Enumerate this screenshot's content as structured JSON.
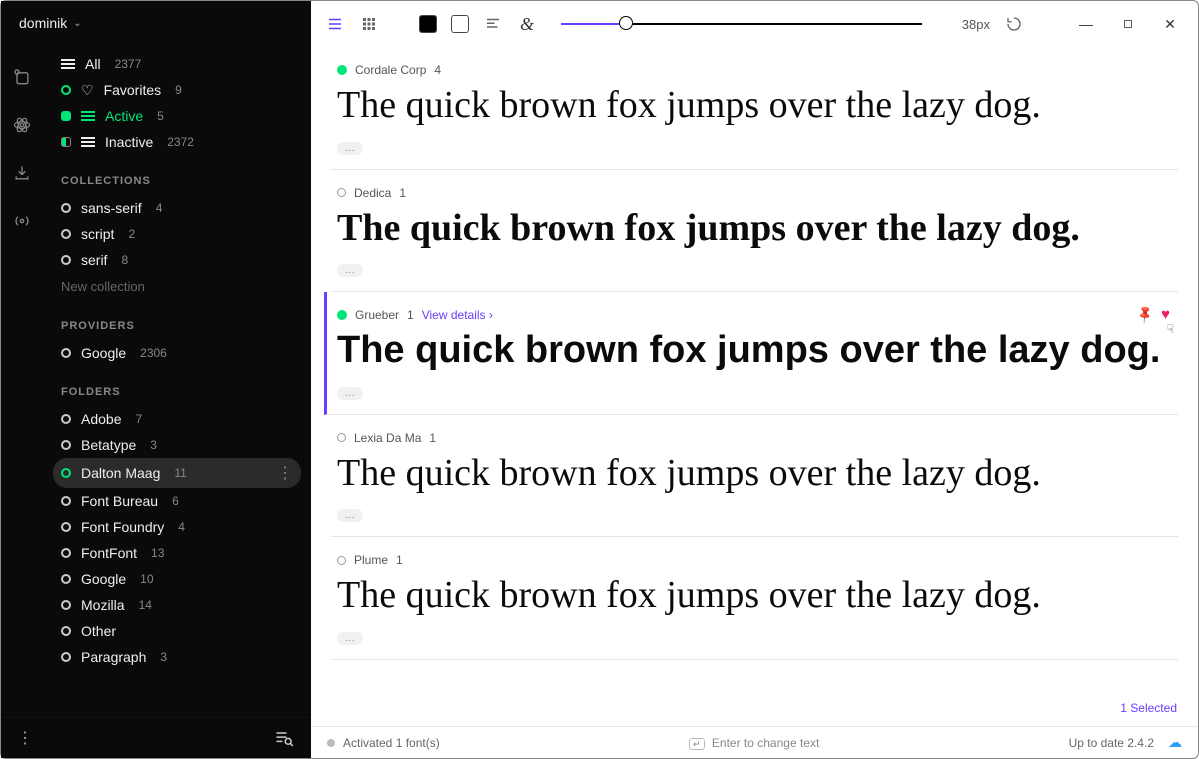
{
  "user": {
    "name": "dominik"
  },
  "filters": {
    "all": {
      "label": "All",
      "count": "2377"
    },
    "favorites": {
      "label": "Favorites",
      "count": "9"
    },
    "active": {
      "label": "Active",
      "count": "5"
    },
    "inactive": {
      "label": "Inactive",
      "count": "2372"
    }
  },
  "sections": {
    "collections": {
      "heading": "COLLECTIONS",
      "new_label": "New collection",
      "items": [
        {
          "label": "sans-serif",
          "count": "4"
        },
        {
          "label": "script",
          "count": "2"
        },
        {
          "label": "serif",
          "count": "8"
        }
      ]
    },
    "providers": {
      "heading": "PROVIDERS",
      "items": [
        {
          "label": "Google",
          "count": "2306"
        }
      ]
    },
    "folders": {
      "heading": "FOLDERS",
      "items": [
        {
          "label": "Adobe",
          "count": "7"
        },
        {
          "label": "Betatype",
          "count": "3"
        },
        {
          "label": "Dalton Maag",
          "count": "11",
          "selected": true
        },
        {
          "label": "Font Bureau",
          "count": "6"
        },
        {
          "label": "Font Foundry",
          "count": "4"
        },
        {
          "label": "FontFont",
          "count": "13"
        },
        {
          "label": "Google",
          "count": "10"
        },
        {
          "label": "Mozilla",
          "count": "14"
        },
        {
          "label": "Other",
          "count": ""
        },
        {
          "label": "Paragraph",
          "count": "3"
        }
      ]
    }
  },
  "toolbar": {
    "size_label": "38px"
  },
  "preview_text": "The quick brown fox jumps over the lazy dog.",
  "fonts": [
    {
      "name": "Cordale Corp",
      "count": "4",
      "status": "active",
      "style": "pv-serif"
    },
    {
      "name": "Dedica",
      "count": "1",
      "status": "inactive",
      "style": "pv-display"
    },
    {
      "name": "Grueber",
      "count": "1",
      "status": "active",
      "style": "pv-slab",
      "selected": true,
      "view_details": "View details ›",
      "favorited": true
    },
    {
      "name": "Lexia Da Ma",
      "count": "1",
      "status": "inactive",
      "style": "pv-sans"
    },
    {
      "name": "Plume",
      "count": "1",
      "status": "inactive",
      "style": "pv-hum"
    }
  ],
  "selected_label": "1 Selected",
  "status": {
    "activated": "Activated 1 font(s)",
    "hint": "Enter to change text",
    "version": "Up to date 2.4.2",
    "enter_key": "↵"
  }
}
